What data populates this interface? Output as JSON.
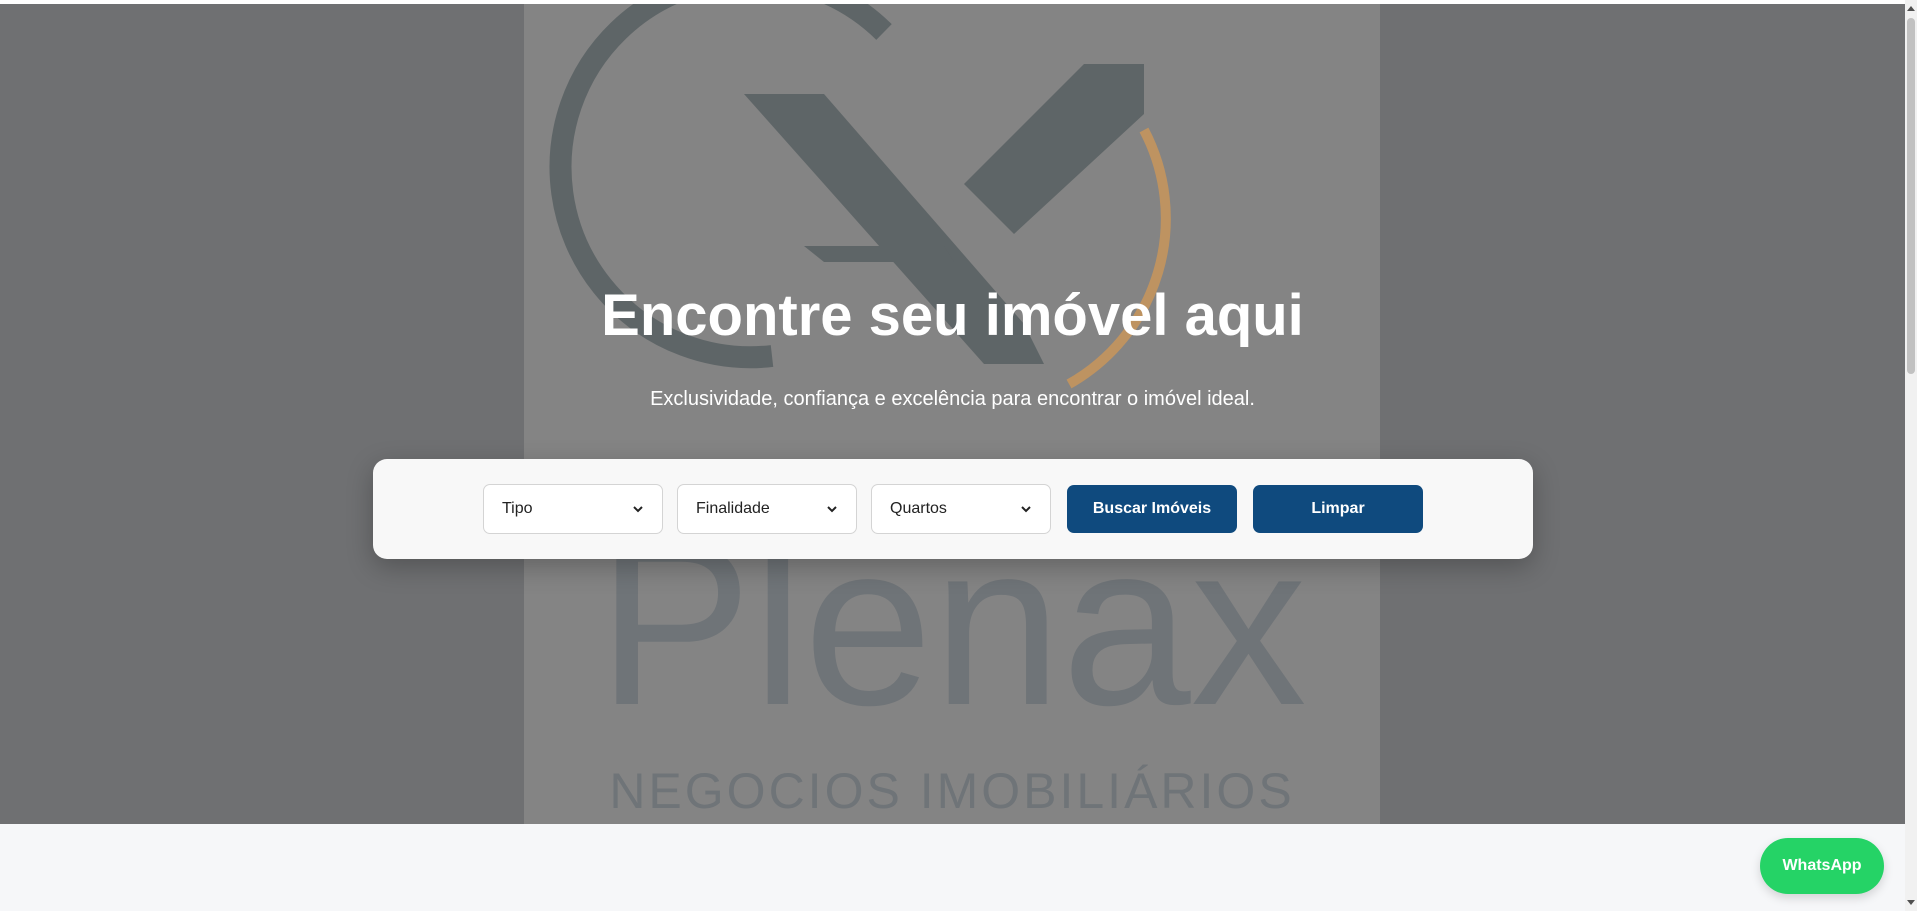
{
  "hero": {
    "title": "Encontre seu imóvel aqui",
    "subtitle": "Exclusividade, confiança e excelência para encontrar o imóvel ideal.",
    "logo": {
      "brand_name": "Plenax",
      "tagline": "NEGOCIOS IMOBILIÁRIOS"
    }
  },
  "search": {
    "tipo": {
      "selected": "Tipo"
    },
    "finalidade": {
      "selected": "Finalidade"
    },
    "quartos": {
      "selected": "Quartos"
    },
    "search_label": "Buscar Imóveis",
    "clear_label": "Limpar"
  },
  "whatsapp": {
    "label": "WhatsApp"
  },
  "colors": {
    "hero_overlay": "#6f7072",
    "logo_panel": "#848484",
    "primary_button": "#0f4a7e",
    "whatsapp": "#25d366",
    "logo_accent": "#c8955a",
    "logo_mark": "#5e6567"
  },
  "icons": {
    "select_chevron": "chevron-down-icon",
    "logo_mark": "plenax-x-logo"
  }
}
